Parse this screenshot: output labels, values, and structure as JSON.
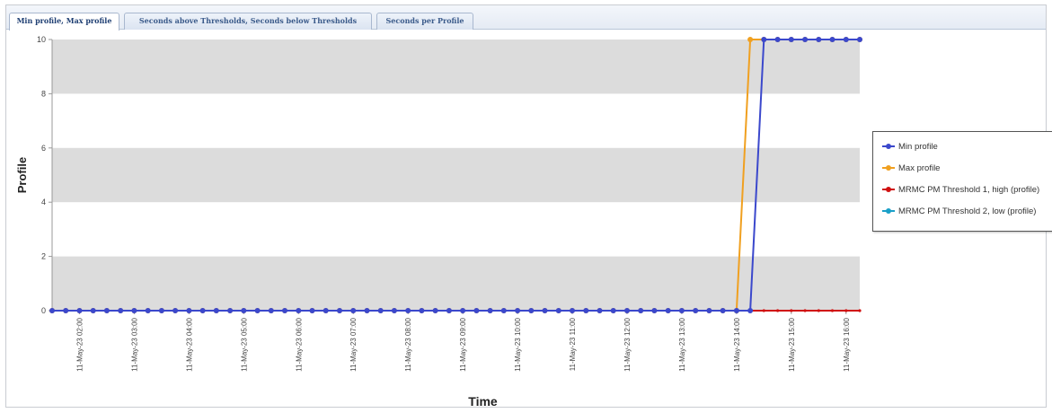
{
  "tabs": [
    {
      "label": "Min profile, Max profile",
      "active": true
    },
    {
      "label": "Seconds above Thresholds, Seconds below Thresholds",
      "active": false
    },
    {
      "label": "Seconds per Profile",
      "active": false
    }
  ],
  "chart_data": {
    "type": "line",
    "title": "",
    "xlabel": "Time",
    "ylabel": "Profile",
    "ylim": [
      0,
      10
    ],
    "y_ticks": [
      "0",
      "2",
      "4",
      "6",
      "8",
      "10"
    ],
    "x_tick_labels": [
      "11-May-23 02:00",
      "11-May-23 03:00",
      "11-May-23 04:00",
      "11-May-23 05:00",
      "11-May-23 06:00",
      "11-May-23 07:00",
      "11-May-23 08:00",
      "11-May-23 09:00",
      "11-May-23 10:00",
      "11-May-23 11:00",
      "11-May-23 12:00",
      "11-May-23 13:00",
      "11-May-23 14:00",
      "11-May-23 15:00",
      "11-May-23 16:00"
    ],
    "x_range": [
      "11-May-23 01:30",
      "11-May-23 16:15"
    ],
    "sample_interval_minutes": 15,
    "grid": "alternating horizontal bands",
    "legend_position": "right",
    "series": [
      {
        "name": "Min profile",
        "color": "#3b48cc",
        "points": [
          [
            "11-May-23 01:30",
            0
          ],
          [
            "11-May-23 14:15",
            0
          ],
          [
            "11-May-23 14:30",
            10
          ],
          [
            "11-May-23 16:15",
            10
          ]
        ]
      },
      {
        "name": "Max profile",
        "color": "#f0a020",
        "points": [
          [
            "11-May-23 01:30",
            0
          ],
          [
            "11-May-23 14:00",
            0
          ],
          [
            "11-May-23 14:15",
            10
          ],
          [
            "11-May-23 16:15",
            10
          ]
        ]
      },
      {
        "name": "MRMC PM Threshold 1, high (profile)",
        "color": "#d01010",
        "points": [
          [
            "11-May-23 14:15",
            0
          ],
          [
            "11-May-23 16:15",
            0
          ]
        ]
      },
      {
        "name": "MRMC PM Threshold 2, low (profile)",
        "color": "#1aa0c8",
        "points": []
      }
    ]
  }
}
